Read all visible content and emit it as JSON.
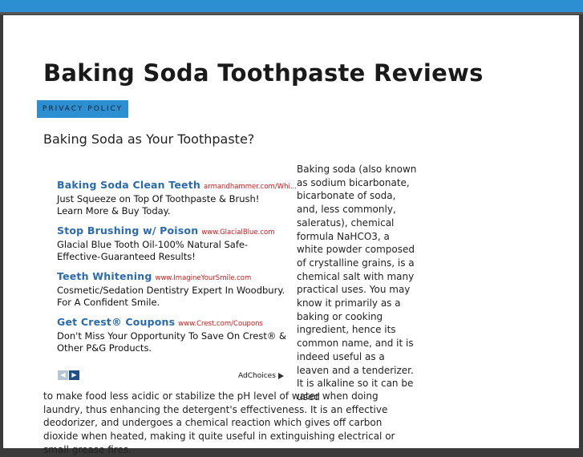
{
  "site": {
    "title": "Baking Soda Toothpaste Reviews"
  },
  "nav": {
    "privacy_label": "PRIVACY POLICY"
  },
  "post": {
    "title": "Baking Soda as Your Toothpaste?",
    "text_right": "Baking soda (also known as sodium bicarbonate, bicarbonate of soda, and, less commonly, saleratus), chemical formula NaHCO3, a white powder composed of crystalline grains, is a chemical salt with many practical uses. You may know it primarily as a baking or cooking ingredient, hence its common name, and it is indeed useful as a leaven and a tenderizer. It is alkaline so it can be used",
    "text_bottom": "to make food less acidic or stabilize the pH level of water when doing laundry, thus enhancing the detergent's effectiveness. It is an effective deodorizer, and undergoes a chemical reaction which gives off carbon dioxide when heated, making it quite useful in extinguishing electrical or small grease fires."
  },
  "ads": [
    {
      "title": "Baking Soda Clean Teeth",
      "url": "armandhammer.com/Whi...",
      "desc1": "Just Squeeze on Top Of Toothpaste & Brush!",
      "desc2": "Learn More & Buy Today."
    },
    {
      "title": "Stop Brushing w/ Poison",
      "url": "www.GlacialBlue.com",
      "desc1": "Glacial Blue Tooth Oil-100% Natural Safe-",
      "desc2": "Effective-Guaranteed Results!"
    },
    {
      "title": "Teeth Whitening",
      "url": "www.ImagineYourSmile.com",
      "desc1": "Cosmetic/Sedation Dentistry Expert In Woodbury.",
      "desc2": "For A Confident Smile."
    },
    {
      "title": "Get Crest® Coupons",
      "url": "www.Crest.com/Coupons",
      "desc1": "Don't Miss Your Opportunity To Save On Crest® &",
      "desc2": "Other P&G Products."
    }
  ],
  "adchoices": {
    "label": "AdChoices"
  },
  "icons": {
    "prev": "chevron-left-icon",
    "next": "chevron-right-icon",
    "adchoices": "adchoices-icon"
  },
  "colors": {
    "accent": "#2b8fd1",
    "ad_link": "#2a6bb0",
    "ad_url": "#d01818"
  }
}
